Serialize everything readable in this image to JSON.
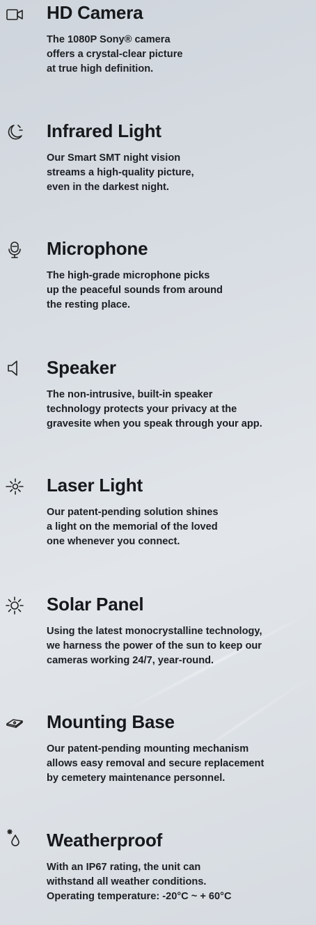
{
  "features": [
    {
      "icon": "video-camera-icon",
      "title": "HD Camera",
      "lines": [
        "The 1080P Sony® camera",
        "offers a crystal-clear picture",
        "at true high definition."
      ]
    },
    {
      "icon": "moon-icon",
      "title": "Infrared Light",
      "lines": [
        "Our Smart SMT night vision",
        "streams a high-quality picture,",
        "even in the darkest night."
      ]
    },
    {
      "icon": "microphone-icon",
      "title": "Microphone",
      "lines": [
        "The high-grade microphone picks",
        "up the peaceful sounds from around",
        "the resting place."
      ]
    },
    {
      "icon": "speaker-icon",
      "title": "Speaker",
      "lines": [
        "The non-intrusive, built-in speaker",
        "technology protects your privacy at the",
        "gravesite when you speak through your app."
      ]
    },
    {
      "icon": "laser-light-icon",
      "title": "Laser Light",
      "lines": [
        "Our patent-pending solution shines",
        "a light on the memorial of the loved",
        "one whenever you connect."
      ]
    },
    {
      "icon": "sun-icon",
      "title": "Solar Panel",
      "lines": [
        "Using the latest monocrystalline technology,",
        "we harness the power of the sun to keep our",
        "cameras working 24/7, year-round."
      ]
    },
    {
      "icon": "mounting-base-icon",
      "title": "Mounting Base",
      "lines": [
        "Our patent-pending mounting mechanism",
        "allows easy removal and secure replacement",
        "by cemetery maintenance personnel."
      ]
    },
    {
      "icon": "weather-drop-icon",
      "title": "Weatherproof",
      "lines": [
        "With an IP67 rating, the unit can",
        "withstand all weather conditions.",
        "Operating temperature: -20°C ~ + 60°C"
      ]
    }
  ]
}
